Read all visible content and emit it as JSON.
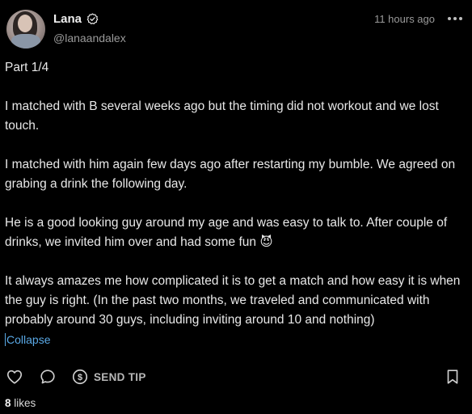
{
  "author": {
    "display_name": "Lana",
    "handle": "@lanaandalex",
    "verified": true
  },
  "post": {
    "timestamp": "11 hours ago",
    "paragraphs": [
      "Part 1/4",
      "I matched with B several weeks ago but the timing did not workout and we lost touch.",
      "I matched with him again few days ago after restarting my bumble. We agreed on grabing a drink the following day.",
      "He is a good looking guy around my age and was easy to talk to. After couple of drinks, we invited him over and had some fun 😈",
      "It always amazes me how complicated it is to get a match and how easy it is when the guy is right. (In the past two months, we traveled and communicated with probably around 30 guys, including inviting around 10 and nothing)"
    ],
    "collapse_label": "Collapse"
  },
  "actions": {
    "like_icon": "heart-icon",
    "comment_icon": "comment-icon",
    "tip_icon": "dollar-circle-icon",
    "tip_label": "SEND TIP",
    "bookmark_icon": "bookmark-icon",
    "more_icon": "more-horizontal-icon"
  },
  "stats": {
    "likes_count": "8",
    "likes_label": "likes"
  },
  "colors": {
    "background": "#000000",
    "text": "#e8e8e8",
    "muted": "#9a9a9a",
    "link": "#5aa9e6"
  }
}
